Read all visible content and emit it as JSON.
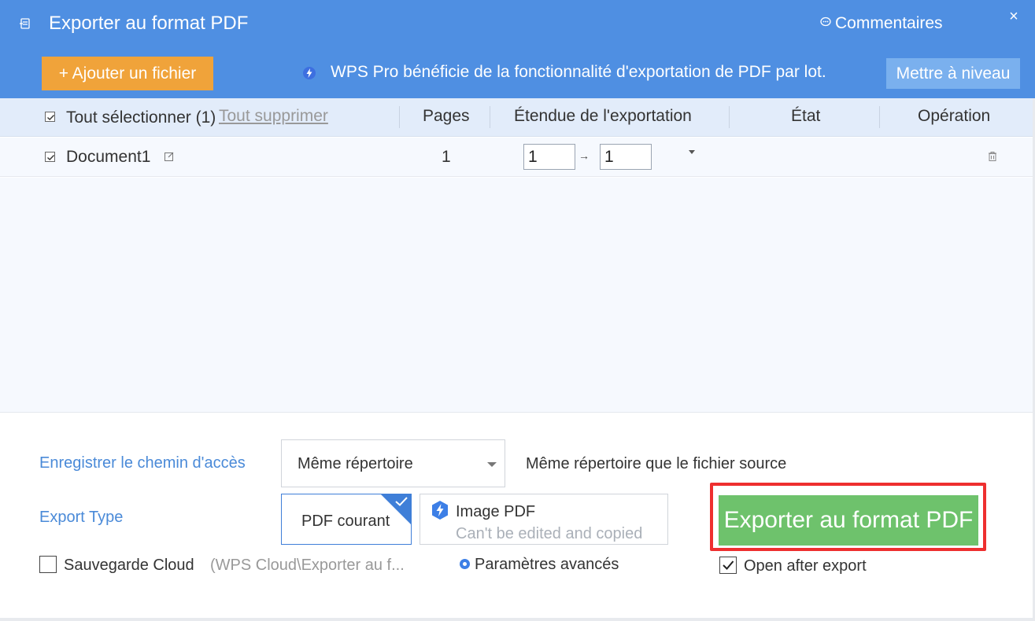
{
  "window": {
    "title": "Exporter au format PDF",
    "comments_label": "Commentaires",
    "close_glyph": "×"
  },
  "toolbar": {
    "add_file_label": "+ Ajouter un fichier",
    "promo_text": "WPS Pro bénéficie de la fonctionnalité d'exportation de PDF par lot.",
    "upgrade_label": "Mettre à niveau"
  },
  "table": {
    "select_all_label": "Tout sélectionner (1)",
    "delete_all_label": "Tout supprimer",
    "columns": {
      "pages": "Pages",
      "range": "Étendue de l'exportation",
      "state": "État",
      "operation": "Opération"
    },
    "rows": [
      {
        "name": "Document1",
        "pages": "1",
        "range_from": "1",
        "range_to": "1",
        "arrow": "→",
        "checked": true
      }
    ]
  },
  "settings": {
    "save_path_label": "Enregistrer le chemin d'accès",
    "save_path_value": "Même répertoire",
    "save_path_desc": "Même répertoire que le fichier source",
    "export_type_label": "Export Type",
    "type_current": "PDF courant",
    "type_image": "Image PDF",
    "type_image_desc": "Can't be edited and copied",
    "cloud_backup_label": "Sauvegarde Cloud",
    "cloud_backup_path": "(WPS Cloud\\Exporter au f...",
    "advanced_label": "Paramètres avancés",
    "export_button_label": "Exporter au format PDF",
    "open_after_label": "Open after export"
  },
  "colors": {
    "header_blue": "#4f8fe2",
    "add_file_orange": "#f0a33a",
    "export_green": "#6ec26c",
    "highlight_red": "#ee2f2f",
    "link_blue": "#4a8ad8"
  }
}
